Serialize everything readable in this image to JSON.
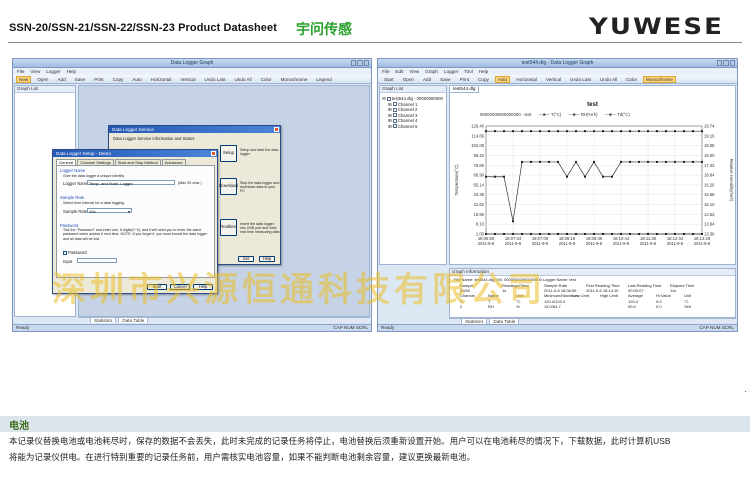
{
  "header": {
    "doc_title": "SSN-20/SSN-21/SSN-22/SSN-23    Product Datasheet",
    "brand_cn": "宇问传感",
    "logo": "YUWESE"
  },
  "left_window": {
    "title": "Data Logger Graph",
    "menu": [
      "File",
      "View",
      "Logger",
      "Help"
    ],
    "toolbar": [
      "New",
      "Open",
      "Add",
      "Save",
      "Print",
      "Copy",
      "Auto",
      "Horizontal",
      "Vertical",
      "Undo Last",
      "Undo All",
      "Color",
      "Monochrome",
      "Legend"
    ],
    "graph_list_title": "Graph List",
    "tabs": [
      "Statistics",
      "Data Table"
    ],
    "status": "Ready",
    "status_right": "CAP  NUM  SCRL"
  },
  "service_dialog": {
    "title": "Data Logger Service",
    "subtitle": "Data Logger Service Information and Status",
    "buttons": [
      {
        "label": "Setup",
        "desc": "Setup and start the data logger"
      },
      {
        "label": "Download",
        "desc": "Stop the data logger and download data to your PC"
      },
      {
        "label": "Realtime",
        "desc": "Insert the data logger into USB port and view real time measuring data"
      }
    ],
    "set_label": "Set",
    "help_label": "Help"
  },
  "setup_dialog": {
    "title": "Data Logger Setup - Demo",
    "tabs": [
      "General",
      "Channel Settings",
      "Start and Stop Method",
      "Advanced"
    ],
    "logger_name_heading": "Logger Name",
    "logger_name_hint": "Give the data logger a unique identity",
    "logger_name_label": "Logger Name",
    "logger_name_value": "Temp. and Humi. Logger",
    "logger_name_max": "(Max 30 char.)",
    "sample_heading": "Sample Rate",
    "sample_hint": "Select time interval for a data logging.",
    "sample_label": "Sample Rate",
    "sample_value": "10s",
    "password_heading": "Password",
    "password_hint": "Tick the \"Password\" and enter one, 6 digits(0~9), and it will need you to enter the same password when access it next time. NOTE: If you forget it, you must format the data logger and all data will be lost.",
    "password_label": "Password",
    "input_label": "Input",
    "start_label": "Start",
    "cancel_label": "Cancel",
    "help_label": "Help"
  },
  "right_window": {
    "title": "test544.dlg - Data Logger Graph",
    "menu": [
      "File",
      "Edit",
      "View",
      "Graph",
      "Logger",
      "Tool",
      "Help"
    ],
    "toolbar": [
      "Start",
      "Open",
      "Add",
      "Save",
      "Print",
      "Copy",
      "Auto",
      "Horizontal",
      "Vertical",
      "Undo Last",
      "Undo All",
      "Color",
      "Monochrome"
    ],
    "graph_list_title": "Graph List",
    "tree_root": "test544.dlg - 00000000000",
    "tree_items": [
      "Channel 1",
      "Channel 2",
      "Channel 3",
      "Channel 4",
      "Channel 5"
    ],
    "doc_tab": "test544.dlg",
    "info_title": "Graph Information",
    "tabs": [
      "Statistics",
      "Data Table"
    ],
    "status": "Ready",
    "status_right": "CAP  NUM  SCRL"
  },
  "chart_data": {
    "type": "line",
    "title": "test",
    "legend": [
      "00000000000000000 - test",
      "T(°C)",
      "RH(%rh)",
      "Td(°C)"
    ],
    "ylabel_left": "Temperature(°C)",
    "ylabel_right": "Relative Humidity(%rh)",
    "y_ticks_left": [
      "126.40",
      "114.66",
      "102.08",
      "90.42",
      "78.66",
      "66.90",
      "55.14",
      "43.38",
      "31.62",
      "19.86",
      "8.10",
      "1.00"
    ],
    "y_ticks_right": [
      "19.74",
      "19.16",
      "18.58",
      "18.00",
      "17.42",
      "16.84",
      "16.26",
      "15.68",
      "15.10",
      "14.52",
      "13.94",
      "13.36"
    ],
    "x_ticks": [
      "18:06:59",
      "18:07:04",
      "18:07:09",
      "18:08:19",
      "18:09:49",
      "18:10:44",
      "18:11:39",
      "18:12:34",
      "18:13:29"
    ],
    "x_dates": [
      "2011-9-6",
      "2011-9-6",
      "2011-9-6",
      "2011-9-6",
      "2011-9-6",
      "2011-9-6",
      "2011-9-6",
      "2011-9-6",
      "2011-9-6"
    ],
    "ylim": [
      1.0,
      126.4
    ],
    "series": [
      {
        "name": "T(°C)",
        "values": [
          120.4,
          120.4,
          120.4,
          120.4,
          120.4,
          120.4,
          120.4,
          120.4,
          120.4,
          120.4,
          120.4,
          120.4,
          120.4,
          120.4,
          120.4,
          120.4,
          120.4,
          120.4,
          120.4,
          120.4,
          120.4,
          120.4,
          120.4,
          120.4,
          120.4
        ]
      },
      {
        "name": "RH(%rh)",
        "values": [
          67.5,
          67.5,
          67.5,
          15.8,
          84.7,
          84.7,
          84.7,
          84.7,
          84.7,
          67.5,
          84.7,
          67.5,
          84.7,
          67.5,
          67.5,
          84.7,
          84.7,
          84.7,
          84.7,
          84.7,
          84.7,
          84.7,
          84.7,
          84.7,
          84.7
        ]
      },
      {
        "name": "Td(°C)",
        "values": [
          1.0,
          1.0,
          1.0,
          1.0,
          1.0,
          1.0,
          1.0,
          1.0,
          1.0,
          1.0,
          1.0,
          1.0,
          1.0,
          1.0,
          1.0,
          1.0,
          1.0,
          1.0,
          1.0,
          1.0,
          1.0,
          1.0,
          1.0,
          1.0,
          1.0
        ]
      }
    ]
  },
  "graph_info": {
    "file_line": "File Name: test544.dlg   S/N: 00000000000000000   Logger Name: test",
    "head": [
      "Sample",
      "Readings/Total",
      "Sample Rate",
      "First Reading Time",
      "Last Reading Time",
      "Elapsed Time"
    ],
    "row1": [
      "50/50",
      "1s",
      "2011-9-6 18:06:59",
      "2011-9-6 18:14:10",
      "00:00:07",
      "11s"
    ],
    "head2": [
      "Channel",
      "Name",
      "Unit",
      "Minimum/Maximum",
      "Low Limit",
      "High Limit",
      "Average",
      "Hi Value",
      "Unit"
    ],
    "row2": [
      "1",
      "T",
      "°C",
      "120.4/120.4",
      "",
      "",
      "120.4",
      "0.0",
      "°C"
    ],
    "row3": [
      "2",
      "RH",
      "%",
      "15.0/84.7",
      "",
      "",
      "90.5",
      "0.0",
      "%rh"
    ]
  },
  "watermark": "深圳市兴源恒通科技有限公司",
  "battery_section": {
    "heading": "电池",
    "line1": "本记录仪替换电池或电池耗尽时，保存的数据不会丢失，此时未完成的记录任务将停止，电池替换后须重新设置开始。用户可以在电池耗尽的情况下，下载数据，此时计算机USB",
    "line2": "将能为记录仪供电。在进行特别重要的记录任务前，用户需核实电池容量，如果不能判断电池剩余容量，建议更换最新电池。"
  },
  "colors": {
    "window_frame": "#7c98c2",
    "brand_green": "#2aa02a",
    "watermark": "#ebbe28",
    "heading_green": "#3d6e1e"
  }
}
